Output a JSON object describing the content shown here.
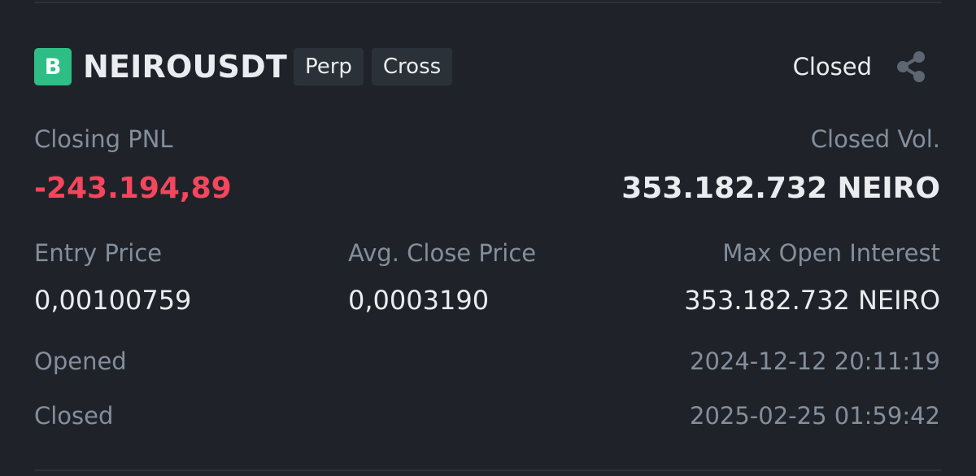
{
  "header": {
    "badge": "B",
    "symbol": "NEIROUSDT",
    "tags": [
      "Perp",
      "Cross"
    ],
    "status": "Closed",
    "share_icon": "share-icon"
  },
  "closing_pnl": {
    "label": "Closing PNL",
    "value": "-243.194,89"
  },
  "closed_vol": {
    "label": "Closed Vol.",
    "value": "353.182.732 NEIRO"
  },
  "entry_price": {
    "label": "Entry Price",
    "value": "0,00100759"
  },
  "avg_close_price": {
    "label": "Avg. Close Price",
    "value": "0,0003190"
  },
  "max_open_interest": {
    "label": "Max Open Interest",
    "value": "353.182.732 NEIRO"
  },
  "opened": {
    "label": "Opened",
    "value": "2024-12-12 20:11:19"
  },
  "closed": {
    "label": "Closed",
    "value": "2025-02-25 01:59:42"
  },
  "colors": {
    "positive": "#2ebd85",
    "negative": "#f6465d",
    "background": "#1f2329"
  }
}
